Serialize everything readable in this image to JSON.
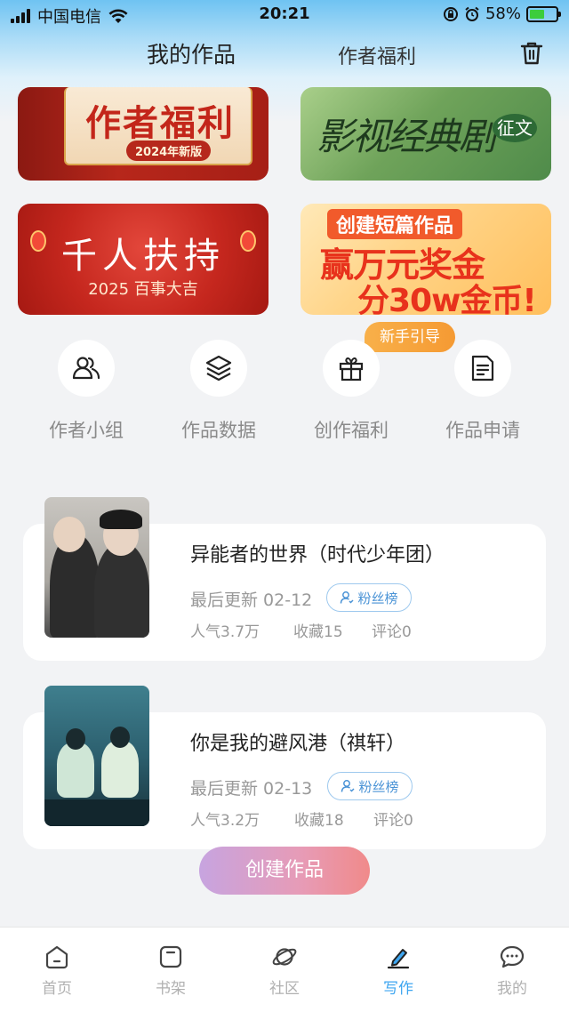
{
  "status_bar": {
    "carrier": "中国电信",
    "time": "20:21",
    "battery": "58%",
    "battery_level": 0.58
  },
  "header": {
    "tab_works": "我的作品",
    "tab_benefits": "作者福利"
  },
  "banners": {
    "author_benefits": {
      "title": "作者福利",
      "tag": "2024年新版"
    },
    "classic_drama": {
      "title": "影视经典剧",
      "badge": "征文"
    },
    "support": {
      "title": "千人扶持",
      "subtitle": "2025 百事大吉"
    },
    "short_story": {
      "line1": "创建短篇作品",
      "line2": "赢万元奖金",
      "line3": "分30w金币!"
    }
  },
  "newbie_guide": "新手引导",
  "quick_actions": [
    {
      "label": "作者小组",
      "icon": "group-icon"
    },
    {
      "label": "作品数据",
      "icon": "layers-icon"
    },
    {
      "label": "创作福利",
      "icon": "gift-icon"
    },
    {
      "label": "作品申请",
      "icon": "document-icon"
    }
  ],
  "works": [
    {
      "title": "异能者的世界（时代少年团）",
      "updated": "最后更新 02-12",
      "fan_list": "粉丝榜",
      "popularity": "人气3.7万",
      "favorites": "收藏15",
      "comments": "评论0"
    },
    {
      "title": "你是我的避风港（祺轩）",
      "updated": "最后更新 02-13",
      "fan_list": "粉丝榜",
      "popularity": "人气3.2万",
      "favorites": "收藏18",
      "comments": "评论0"
    }
  ],
  "create_button": "创建作品",
  "bottom_nav": [
    {
      "label": "首页",
      "icon": "home-icon",
      "active": false
    },
    {
      "label": "书架",
      "icon": "bookshelf-icon",
      "active": false
    },
    {
      "label": "社区",
      "icon": "planet-icon",
      "active": false
    },
    {
      "label": "写作",
      "icon": "pen-icon",
      "active": true
    },
    {
      "label": "我的",
      "icon": "chat-icon",
      "active": false
    }
  ],
  "colors": {
    "accent_blue": "#3ea6f0",
    "create_gradient_start": "#c7a4e0",
    "create_gradient_end": "#f08a8a",
    "newbie_orange": "#f59a33"
  }
}
